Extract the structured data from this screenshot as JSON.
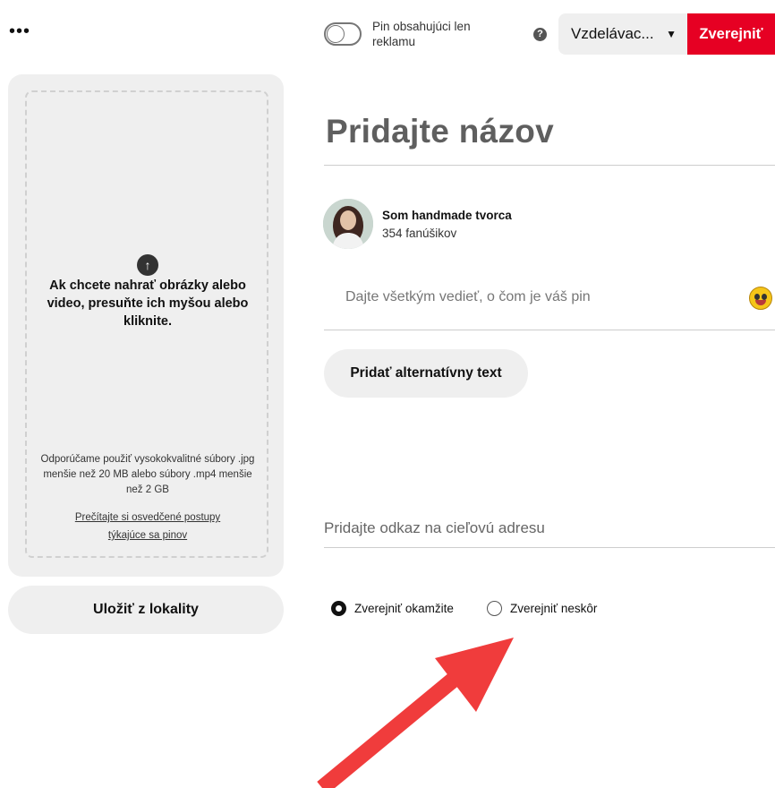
{
  "topbar": {
    "more_icon": "•••",
    "ad_only_label": "Pin obsahujúci len reklamu",
    "ad_only_on": false,
    "help_icon": "?",
    "board_select": "Vzdelávac...",
    "publish_button": "Zverejniť"
  },
  "upload": {
    "upload_arrow": "↑",
    "instructions": "Ak chcete nahrať obrázky alebo video, presuňte ich myšou alebo kliknite.",
    "hint": "Odporúčame použiť vysokokvalitné súbory .jpg menšie než 20 MB alebo súbory .mp4 menšie než 2 GB",
    "best_practices_link": "Prečítajte si osvedčené postupy týkajúce sa pinov",
    "save_from_site": "Uložiť z lokality"
  },
  "form": {
    "title_placeholder": "Pridajte názov",
    "user_name": "Som handmade tvorca",
    "user_followers": "354 fanúšikov",
    "description_placeholder": "Dajte všetkým vedieť, o čom je váš pin",
    "alt_text_button": "Pridať alternatívny text",
    "link_placeholder": "Pridajte odkaz na cieľovú adresu"
  },
  "publish_options": {
    "now_label": "Zverejniť okamžite",
    "later_label": "Zverejniť neskôr",
    "selected": "now"
  },
  "colors": {
    "accent_red": "#e60023",
    "arrow_red": "#f03c3c"
  }
}
